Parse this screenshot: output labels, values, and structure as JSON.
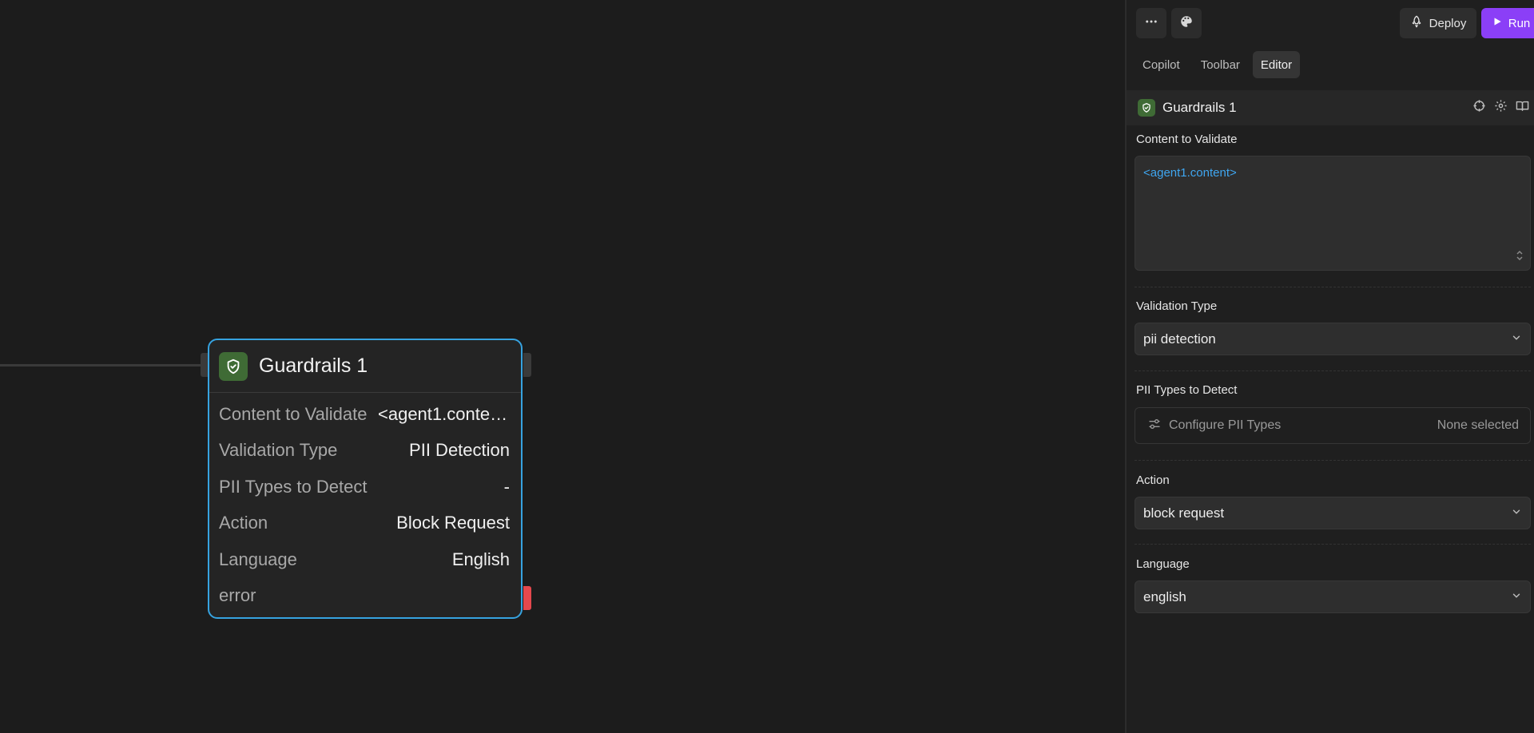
{
  "canvas": {
    "node": {
      "title": "Guardrails 1",
      "rows": [
        {
          "label": "Content to Validate",
          "value": "<agent1.content>"
        },
        {
          "label": "Validation Type",
          "value": "PII Detection"
        },
        {
          "label": "PII Types to Detect",
          "value": "-"
        },
        {
          "label": "Action",
          "value": "Block Request"
        },
        {
          "label": "Language",
          "value": "English"
        },
        {
          "label": "error",
          "value": ""
        }
      ]
    }
  },
  "topbar": {
    "more_icon": "more-horizontal-icon",
    "theme_icon": "palette-icon",
    "deploy_label": "Deploy",
    "run_label": "Run",
    "run_color": "#8b3ff7"
  },
  "tabs": [
    {
      "label": "Copilot",
      "active": false
    },
    {
      "label": "Toolbar",
      "active": false
    },
    {
      "label": "Editor",
      "active": true
    }
  ],
  "editor": {
    "block_title": "Guardrails 1",
    "block_icon": "shield-check-icon",
    "block_color": "#3f6b35",
    "content_label": "Content to Validate",
    "content_value": "<agent1.content>",
    "validation_label": "Validation Type",
    "validation_value": "pii detection",
    "pii_label": "PII Types to Detect",
    "pii_button": "Configure PII Types",
    "pii_status": "None selected",
    "action_label": "Action",
    "action_value": "block request",
    "language_label": "Language",
    "language_value": "english"
  }
}
